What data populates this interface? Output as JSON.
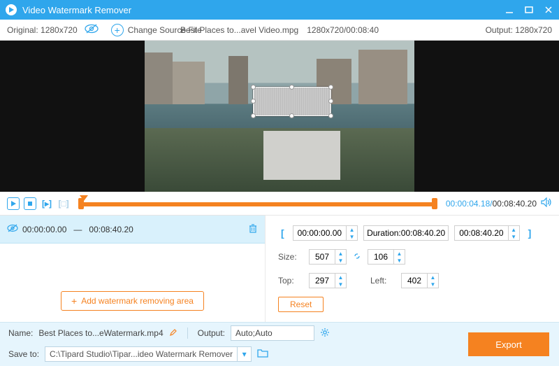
{
  "titlebar": {
    "title": "Video Watermark Remover"
  },
  "toolbar": {
    "original_label": "Original: 1280x720",
    "change_label": "Change Source File",
    "filename": "Best Places to...avel Video.mpg",
    "fileres": "1280x720/00:08:40",
    "output_label": "Output: 1280x720"
  },
  "timeline": {
    "current": "00:00:04.18",
    "total": "00:08:40.20"
  },
  "segment": {
    "start": "00:00:00.00",
    "end": "00:08:40.20"
  },
  "add_area_label": "Add watermark removing area",
  "range": {
    "start": "00:00:00.00",
    "duration_label": "Duration:",
    "duration": "00:08:40.20",
    "end": "00:08:40.20"
  },
  "size": {
    "label": "Size:",
    "w": "507",
    "h": "106"
  },
  "pos": {
    "top_label": "Top:",
    "top": "297",
    "left_label": "Left:",
    "left": "402"
  },
  "reset_label": "Reset",
  "bottom": {
    "name_label": "Name:",
    "name_value": "Best Places to...eWatermark.mp4",
    "output_label": "Output:",
    "output_value": "Auto;Auto",
    "save_label": "Save to:",
    "save_value": "C:\\Tipard Studio\\Tipar...ideo Watermark Remover",
    "export_label": "Export"
  }
}
